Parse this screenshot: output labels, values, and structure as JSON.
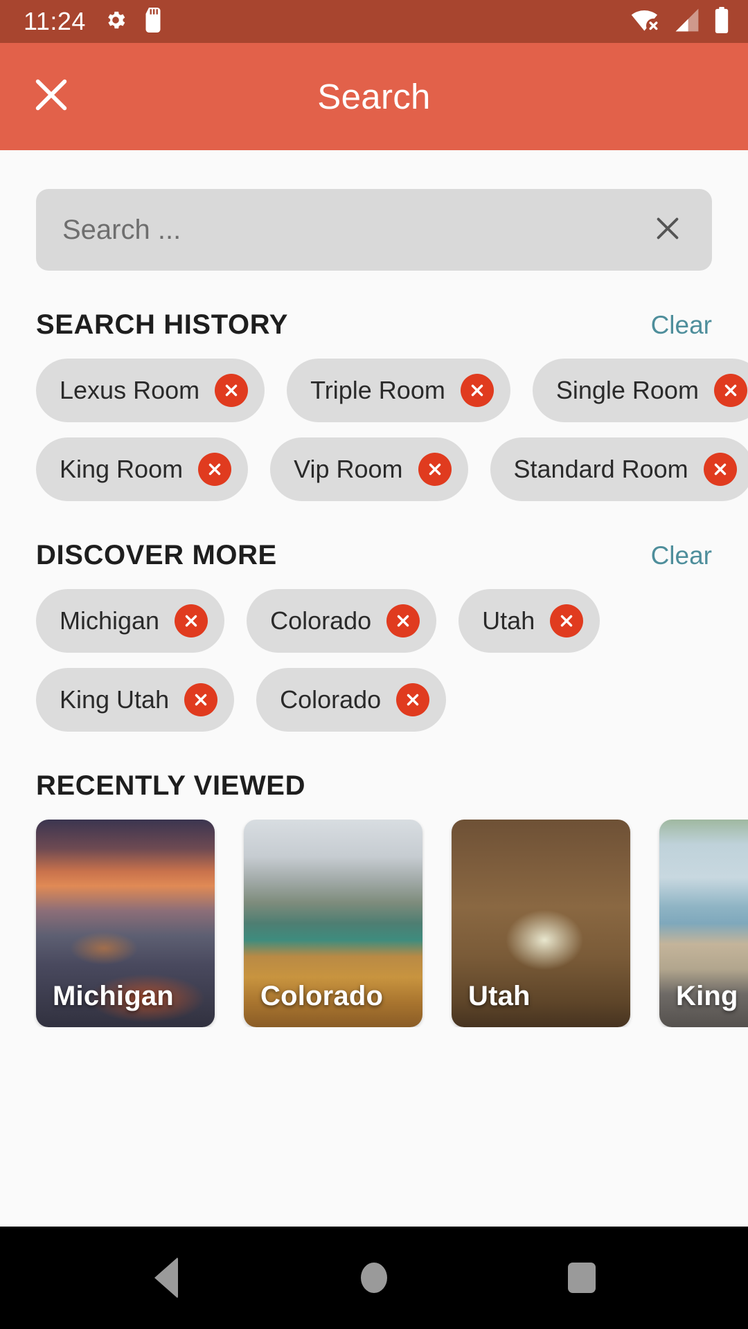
{
  "status_bar": {
    "time": "11:24",
    "icons": [
      "gear-icon",
      "sd-card-icon",
      "wifi-off-icon",
      "cellular-signal-icon",
      "battery-icon"
    ],
    "background": "#A8452F"
  },
  "app_bar": {
    "title": "Search",
    "close_label": "close-icon",
    "background": "#E2614A",
    "text_color": "#FFFFFF"
  },
  "search": {
    "value": "",
    "placeholder": "Search ...",
    "clear_label": "clear-icon",
    "background": "#D9D9D9"
  },
  "sections": {
    "search_history": {
      "title": "SEARCH HISTORY",
      "clear_label": "Clear",
      "rows": [
        [
          "Lexus Room",
          "Triple Room",
          "Single Room"
        ],
        [
          "King Room",
          "Vip Room",
          "Standard Room"
        ]
      ]
    },
    "discover_more": {
      "title": "DISCOVER MORE",
      "clear_label": "Clear",
      "rows": [
        [
          "Michigan",
          "Colorado",
          "Utah"
        ],
        [
          "King Utah",
          "Colorado"
        ]
      ]
    },
    "recently_viewed": {
      "title": "RECENTLY VIEWED",
      "cards": [
        {
          "caption": "Michigan",
          "art": "coastal-sunset-village"
        },
        {
          "caption": "Colorado",
          "art": "boat-on-alpine-lake"
        },
        {
          "caption": "Utah",
          "art": "travel-flatlay-map-camera-notebook"
        },
        {
          "caption": "King",
          "art": "beach-bench-surfers"
        }
      ]
    }
  },
  "nav_bar": {
    "buttons": [
      "back-button",
      "home-button",
      "recents-button"
    ],
    "background": "#000000"
  },
  "colors": {
    "status_bar": "#A8452F",
    "app_bar": "#E2614A",
    "page_background": "#FAFAFA",
    "chip_background": "#DCDCDC",
    "chip_delete": "#E03B1F",
    "clear_link": "#4E8E9B",
    "search_field": "#D9D9D9"
  }
}
